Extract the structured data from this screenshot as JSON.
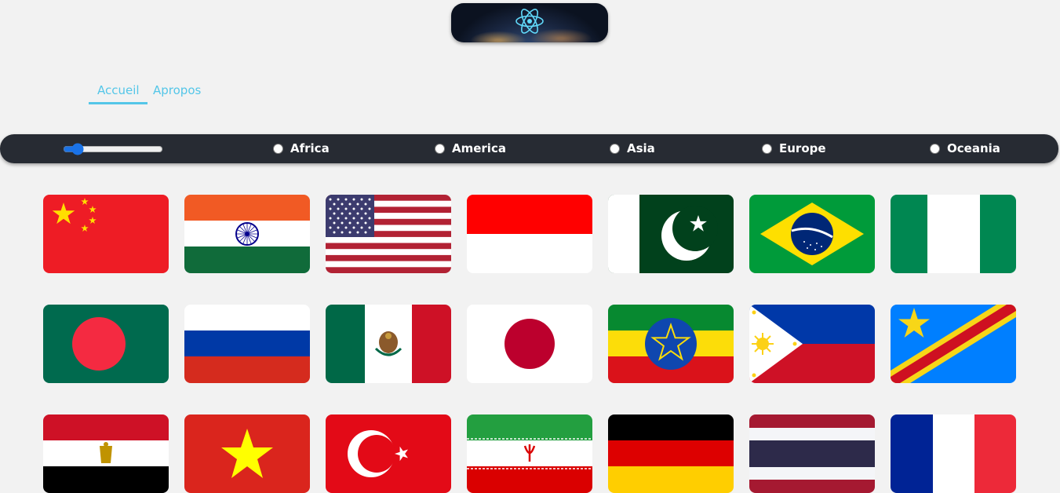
{
  "header": {
    "logo_icon": "react-atom-icon"
  },
  "nav": {
    "items": [
      {
        "label": "Accueil",
        "active": true
      },
      {
        "label": "Apropos",
        "active": false
      }
    ]
  },
  "filters": {
    "range_value": 0.1,
    "regions": [
      "Africa",
      "America",
      "Asia",
      "Europe",
      "Oceania"
    ]
  },
  "countries": [
    "china",
    "india",
    "united-states",
    "indonesia",
    "pakistan",
    "brazil",
    "nigeria",
    "bangladesh",
    "russia",
    "mexico",
    "japan",
    "ethiopia",
    "philippines",
    "dr-congo",
    "egypt",
    "vietnam",
    "turkey",
    "iran",
    "germany",
    "thailand",
    "france"
  ]
}
